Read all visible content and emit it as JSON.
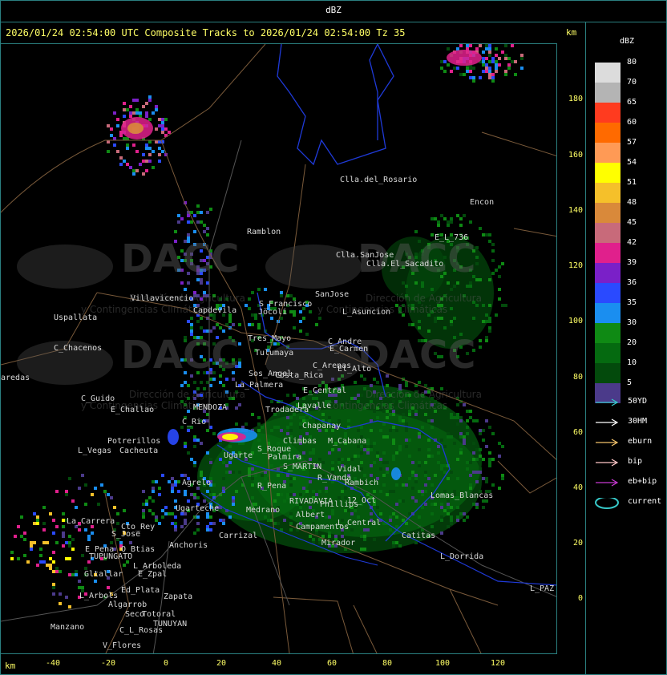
{
  "header": {
    "title": "dBZ"
  },
  "subtitle": "2026/01/24 02:54:00 UTC Composite Tracks to 2026/01/24 02:54:00 Tz 35",
  "km_top": "km",
  "km_bottom": "km",
  "legend": {
    "title": "dBZ",
    "bins": [
      {
        "label": "80",
        "color": "#dcdcdc"
      },
      {
        "label": "70",
        "color": "#b4b4b4"
      },
      {
        "label": "65",
        "color": "#ff3b1f"
      },
      {
        "label": "60",
        "color": "#ff6a00"
      },
      {
        "label": "57",
        "color": "#ff9a55"
      },
      {
        "label": "54",
        "color": "#ffff00"
      },
      {
        "label": "51",
        "color": "#f5c02a"
      },
      {
        "label": "48",
        "color": "#d9893a"
      },
      {
        "label": "45",
        "color": "#c86a7a"
      },
      {
        "label": "42",
        "color": "#e0208c"
      },
      {
        "label": "39",
        "color": "#7a20c8"
      },
      {
        "label": "36",
        "color": "#2a4aff"
      },
      {
        "label": "35",
        "color": "#1a8ef0"
      },
      {
        "label": "30",
        "color": "#0f8a14"
      },
      {
        "label": "20",
        "color": "#056a10"
      },
      {
        "label": "10",
        "color": "#034a0c"
      },
      {
        "label": "5",
        "color": "#4b3a8a"
      }
    ],
    "tracks": [
      {
        "label": "50YD",
        "color": "#37c8c8"
      },
      {
        "label": "30HM",
        "color": "#ffffff"
      },
      {
        "label": "eburn",
        "color": "#f2c36b"
      },
      {
        "label": "bip",
        "color": "#ffc8c8"
      },
      {
        "label": "eb+bip",
        "color": "#c83ad2"
      },
      {
        "label": "current",
        "color": "#37c8c8",
        "shape": "ellipse"
      }
    ]
  },
  "y_axis": [
    "180",
    "160",
    "140",
    "120",
    "100",
    "80",
    "60",
    "40",
    "20",
    "0"
  ],
  "x_axis": [
    "-40",
    "-20",
    "0",
    "20",
    "40",
    "60",
    "80",
    "100",
    "120"
  ],
  "places": [
    {
      "name": "Clla.del_Rosario"
    },
    {
      "name": "Encon"
    },
    {
      "name": "E_L_736"
    },
    {
      "name": "Ramblon"
    },
    {
      "name": "Clla.SanJose"
    },
    {
      "name": "Clla.El_Sacadito"
    },
    {
      "name": "Villavicencio"
    },
    {
      "name": "S_Francisco"
    },
    {
      "name": "SanJose"
    },
    {
      "name": "Uspallata"
    },
    {
      "name": "Capdevila"
    },
    {
      "name": "Jocoli"
    },
    {
      "name": "L_Asuncion"
    },
    {
      "name": "C_Chacenos"
    },
    {
      "name": "Tres_Mayo"
    },
    {
      "name": "C_Andre"
    },
    {
      "name": "Tulumaya"
    },
    {
      "name": "E_Carmen"
    },
    {
      "name": "aredas"
    },
    {
      "name": "C_Arenas"
    },
    {
      "name": "El_Alto"
    },
    {
      "name": "Sos_Angel"
    },
    {
      "name": "Costa_Rica"
    },
    {
      "name": "La_Palmera"
    },
    {
      "name": "C_Guido"
    },
    {
      "name": "E_Central"
    },
    {
      "name": "Lavalle"
    },
    {
      "name": "E_Challao"
    },
    {
      "name": "MENDOZA"
    },
    {
      "name": "Trodadera"
    },
    {
      "name": "C_Rio"
    },
    {
      "name": "Chapanay"
    },
    {
      "name": "Potrerillos"
    },
    {
      "name": "L_Vegas"
    },
    {
      "name": "Cacheuta"
    },
    {
      "name": "Climbas"
    },
    {
      "name": "M_Cabana"
    },
    {
      "name": "S_Roque"
    },
    {
      "name": "Palmira"
    },
    {
      "name": "Ugarte"
    },
    {
      "name": "S_MARTIN"
    },
    {
      "name": "Vidal"
    },
    {
      "name": "R_Vanda"
    },
    {
      "name": "Rambich"
    },
    {
      "name": "Agrelo"
    },
    {
      "name": "R_Pena"
    },
    {
      "name": "RIVADAVIA"
    },
    {
      "name": "Phillips"
    },
    {
      "name": "12_Oct"
    },
    {
      "name": "Lomas_Blancas"
    },
    {
      "name": "Ugarteche"
    },
    {
      "name": "Medrano"
    },
    {
      "name": "Albert"
    },
    {
      "name": "La_Carrera"
    },
    {
      "name": "Cto_Rey"
    },
    {
      "name": "S_Jose"
    },
    {
      "name": "L_Central"
    },
    {
      "name": "Campamentos"
    },
    {
      "name": "Carrizal"
    },
    {
      "name": "Catitas"
    },
    {
      "name": "E_Pena"
    },
    {
      "name": "O_Btias"
    },
    {
      "name": "TUPUNGATO"
    },
    {
      "name": "Anchoris"
    },
    {
      "name": "Mirador"
    },
    {
      "name": "L_Dorrida"
    },
    {
      "name": "L_Arboleda"
    },
    {
      "name": "Gltallar"
    },
    {
      "name": "E_Zpal"
    },
    {
      "name": "Ed_Plata"
    },
    {
      "name": "L_Arbols"
    },
    {
      "name": "Zapata"
    },
    {
      "name": "Algarrob"
    },
    {
      "name": "Seco"
    },
    {
      "name": "Totoral"
    },
    {
      "name": "TUNUYAN"
    },
    {
      "name": "Manzano"
    },
    {
      "name": "C_L_Rosas"
    },
    {
      "name": "V_Flores"
    },
    {
      "name": "L_PAZ"
    }
  ],
  "watermarks": [
    {
      "big": "DACC",
      "line1": "Dirección de Agricultura",
      "line2": "y Contingencias Climáticas"
    },
    {
      "big": "DACC",
      "line1": "Dirección de Agricultura",
      "line2": "y Contingencias Climáticas"
    },
    {
      "big": "DACC",
      "line1": "Dirección de Agricultura",
      "line2": "y Contingencias Climáticas"
    },
    {
      "big": "DACC",
      "line1": "Dirección de Agricultura",
      "line2": "y Contingencias Climáticas"
    }
  ]
}
